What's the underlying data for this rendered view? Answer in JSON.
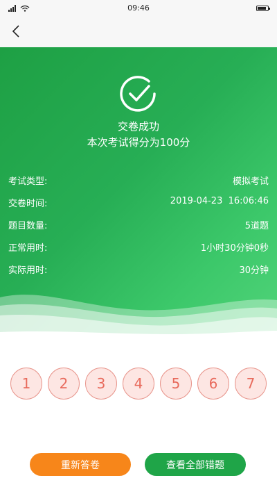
{
  "status_bar": {
    "time": "09:46"
  },
  "result": {
    "title": "交卷成功",
    "score_text": "本次考试得分为100分"
  },
  "info": [
    {
      "label": "考试类型:",
      "value": "模拟考试"
    },
    {
      "label": "交卷时间:",
      "value": "2019-04-23  16:06:46"
    },
    {
      "label": "题目数量:",
      "value": "5道题"
    },
    {
      "label": "正常用时:",
      "value": "1小时30分钟0秒"
    },
    {
      "label": "实际用时:",
      "value": "30分钟"
    }
  ],
  "questions": [
    "1",
    "2",
    "3",
    "4",
    "5",
    "6",
    "7"
  ],
  "buttons": {
    "retry": "重新答卷",
    "review_wrong": "查看全部错题"
  },
  "colors": {
    "green": "#27ae55",
    "orange": "#f7861a",
    "question_border": "#e8958c",
    "question_fill": "#fde6e3"
  }
}
